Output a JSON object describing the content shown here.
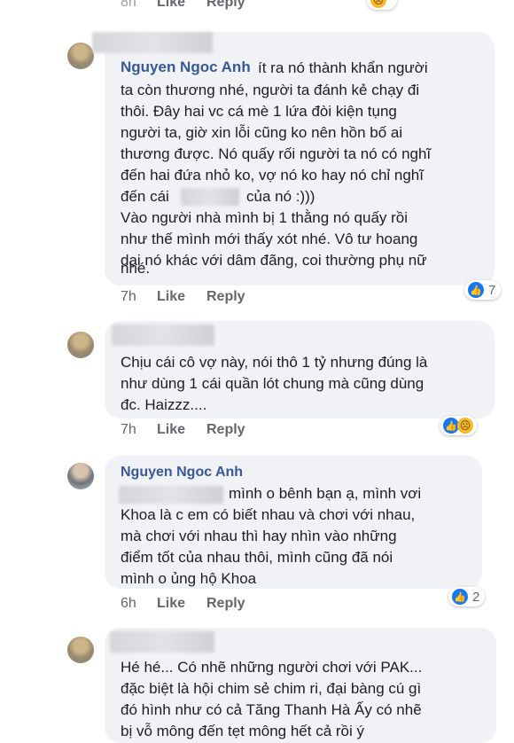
{
  "top_partial": {
    "time": "8h",
    "like": "Like",
    "reply": "Reply"
  },
  "comments": [
    {
      "name": "Nguyen Ngoc Anh",
      "first_line_text": " ít ra nó thành khẩn người",
      "lines": [
        "ta còn thương nhé, người ta đánh kẻ chạy đi",
        "thôi. Đây hai vc cá mè 1 lứa đòi kiện tụng",
        "người ta, giờ xin lỗi cũng ko nên hồn bố ai",
        "thương được. Nó quấy rối người ta nó có nghĩ",
        "đến hai đứa nhỏ ko, vợ nó ko hay nó chỉ nghĩ",
        "đến cái",
        "của nó :)))",
        "Vào người nhà mình bị 1 thằng nó quấy rồi",
        "như thế mình mới thấy xót nhé. Vô tư hoang",
        "dại nó khác với dâm đãng, coi thường phụ nữ",
        "nhé."
      ],
      "time": "7h",
      "like": "Like",
      "reply": "Reply",
      "reaction_count": "7"
    },
    {
      "lines": [
        "Chịu cái cô vợ này, nói thô 1 tỷ nhưng đúng là",
        "như dùng 1 cái quần lót chung mà cũng dùng",
        "đc. Haizzz...."
      ],
      "time": "7h",
      "like": "Like",
      "reply": "Reply"
    },
    {
      "name": "Nguyen Ngoc Anh",
      "lines": [
        "mình o bênh bạn ạ, mình vơi",
        "Khoa là c em có biết nhau và chơi với nhau,",
        "mà chơi với nhau thì hay nhìn vào những",
        "điểm tốt của nhau thôi, mình cũng đã nói",
        "mình o ủng hộ Khoa"
      ],
      "time": "6h",
      "like": "Like",
      "reply": "Reply",
      "reaction_count": "2"
    },
    {
      "lines": [
        "Hé hé... Có nhẽ những người chơi với PAK...",
        "đặc biệt là hội chim sẻ chim ri, đại bàng cú gì",
        "đó hình như có cả Tăng Thanh Hà Ấy có nhẽ",
        "bị vỗ mông đến tẹt mông hết cả rồi ý"
      ]
    }
  ],
  "icons": {
    "like": "thumbs-up-icon",
    "sad": "sad-face-icon"
  },
  "colors": {
    "name": "#385898",
    "bubble": "#f0f2f5",
    "like_blue": "#1877f2"
  }
}
